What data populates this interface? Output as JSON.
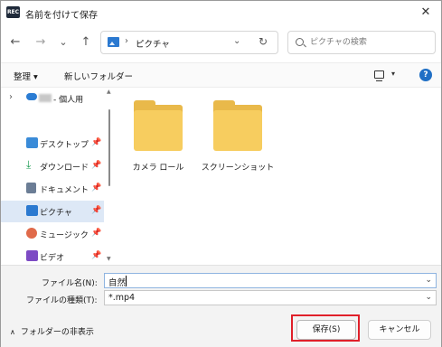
{
  "window": {
    "app_icon_text": "REC",
    "title": "名前を付けて保存",
    "close_glyph": "✕"
  },
  "nav": {
    "back_glyph": "←",
    "forward_glyph": "→",
    "recent_glyph": "⌄",
    "up_glyph": "↑"
  },
  "address": {
    "separator": "›",
    "path": "ピクチャ",
    "dropdown_glyph": "⌄",
    "refresh_glyph": "↻"
  },
  "search": {
    "placeholder": "ピクチャの検索"
  },
  "commandbar": {
    "organize_label": "整理 ▾",
    "new_folder_label": "新しいフォルダー",
    "view_dropdown_glyph": "▾",
    "help_glyph": "?"
  },
  "sidebar": {
    "items": [
      {
        "label": "- 個人用",
        "icon": "cloud-icon",
        "pinned": false
      },
      {
        "label": "デスクトップ",
        "icon": "desktop-icon",
        "pinned": true
      },
      {
        "label": "ダウンロード",
        "icon": "download-icon",
        "pinned": true
      },
      {
        "label": "ドキュメント",
        "icon": "document-icon",
        "pinned": true
      },
      {
        "label": "ピクチャ",
        "icon": "pictures-icon",
        "pinned": true,
        "selected": true
      },
      {
        "label": "ミュージック",
        "icon": "music-icon",
        "pinned": true
      },
      {
        "label": "ビデオ",
        "icon": "video-icon",
        "pinned": true
      }
    ],
    "pin_glyph": "📌",
    "expand_glyph": "›"
  },
  "content": {
    "folders": [
      {
        "name": "カメラ ロール"
      },
      {
        "name": "スクリーンショット"
      }
    ]
  },
  "form": {
    "filename_label": "ファイル名(N):",
    "filename_value": "自然",
    "filetype_label": "ファイルの種類(T):",
    "filetype_value": "*.mp4",
    "dropdown_glyph": "⌄"
  },
  "footer": {
    "hide_folders_label": "フォルダーの非表示",
    "hide_chevron": "∧",
    "save_label": "保存(S)",
    "cancel_label": "キャンセル"
  },
  "colors": {
    "accent": "#1f6fc5",
    "selected_bg": "#dde8f6",
    "folder_front": "#f7cd5f",
    "folder_back": "#e9b94a",
    "highlight_outline": "#e0202a"
  }
}
